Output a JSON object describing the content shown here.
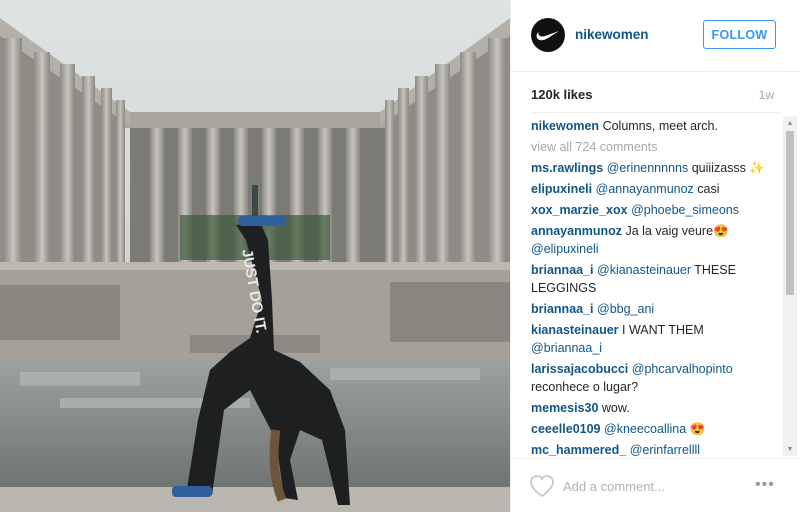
{
  "post": {
    "username": "nikewomen",
    "follow_label": "FOLLOW",
    "likes": "120k likes",
    "time_ago": "1w",
    "caption_user": "nikewomen",
    "caption_text": "Columns, meet arch.",
    "view_all": "view all 724 comments",
    "photo_text": "JUST DO IT.",
    "add_comment_placeholder": "Add a comment...",
    "more_label": "•••"
  },
  "comments": [
    {
      "user": "ms.rawlings",
      "mention": "@erinennnnns",
      "text": "quiiizasss ✨"
    },
    {
      "user": "elipuxineli",
      "mention": "@annayanmunoz",
      "text": "casi"
    },
    {
      "user": "xox_marzie_xox",
      "mention": "@phoebe_simeons",
      "text": ""
    },
    {
      "user": "annayanmunoz",
      "mention": "",
      "text": "Ja la vaig veure😍",
      "mention_after": "@elipuxineli"
    },
    {
      "user": "briannaa_i",
      "mention": "@kianasteinauer",
      "text": "THESE LEGGINGS"
    },
    {
      "user": "briannaa_i",
      "mention": "@bbg_ani",
      "text": ""
    },
    {
      "user": "kianasteinauer",
      "mention": "",
      "text": "I WANT THEM",
      "mention_after": "@briannaa_i"
    },
    {
      "user": "larissajacobucci",
      "mention": "@phcarvalhopinto",
      "text": "reconhece o lugar?"
    },
    {
      "user": "memesis30",
      "mention": "",
      "text": "wow."
    },
    {
      "user": "ceeelle0109",
      "mention": "@kneecoallina",
      "text": "😍"
    },
    {
      "user": "mc_hammered_",
      "mention": "@erinfarrellll",
      "text": ""
    }
  ],
  "icons": {
    "avatar": "nike-swoosh-logo",
    "like": "heart-icon",
    "more": "more-options-icon",
    "scroll_up": "scroll-up-arrow-icon",
    "scroll_down": "scroll-down-arrow-icon"
  },
  "colors": {
    "link": "#125688",
    "follow": "#3897f0",
    "muted": "#a5a7aa"
  }
}
